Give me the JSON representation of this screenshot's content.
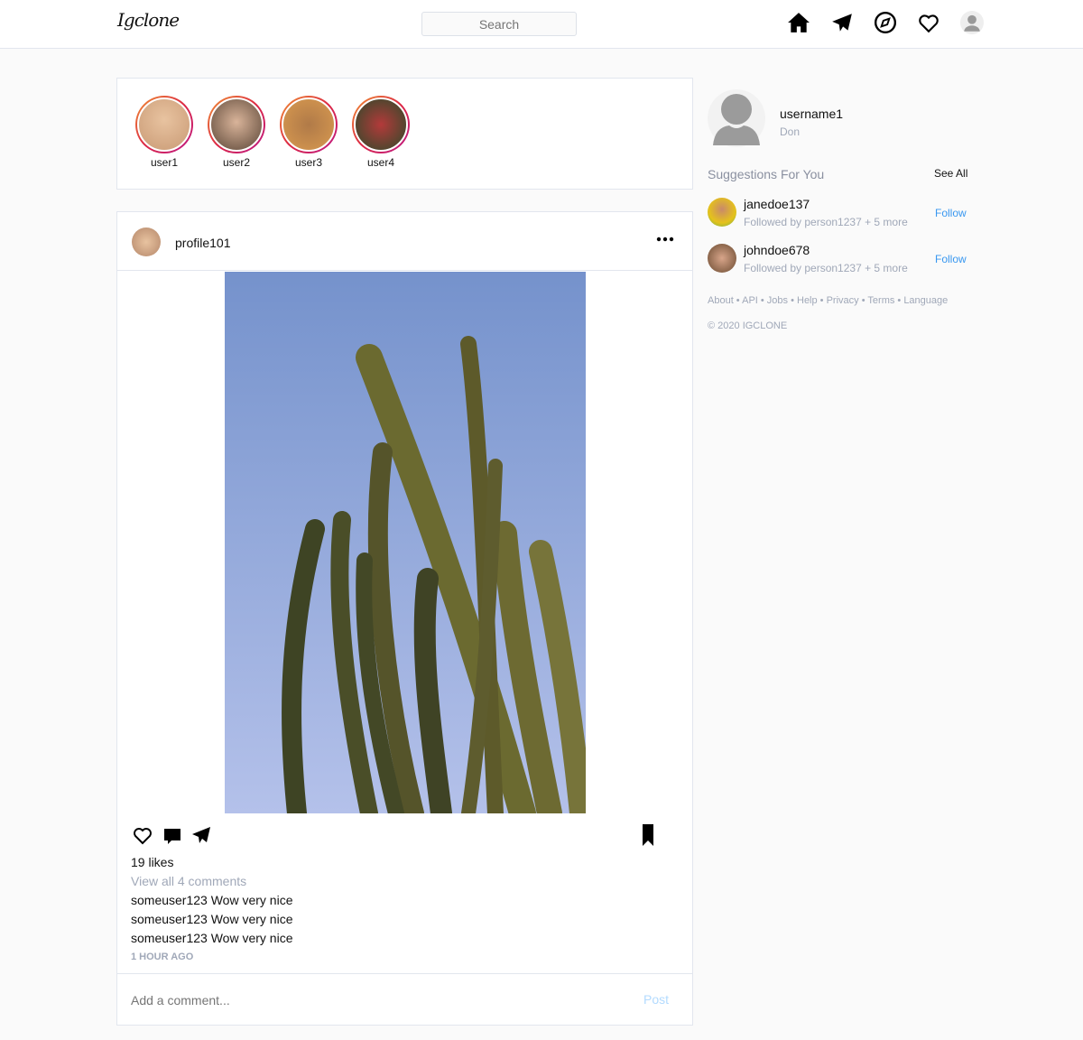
{
  "header": {
    "logo": "Igclone",
    "search_placeholder": "Search",
    "icons": [
      "home-icon",
      "send-icon",
      "explore-icon",
      "heart-icon",
      "profile-icon"
    ]
  },
  "stories": [
    {
      "label": "user1"
    },
    {
      "label": "user2"
    },
    {
      "label": "user3"
    },
    {
      "label": "user4"
    }
  ],
  "post": {
    "username": "profile101",
    "likes": "19 likes",
    "view_comments": "View all 4 comments",
    "comments": [
      {
        "user": "someuser123",
        "text": "Wow very nice"
      },
      {
        "user": "someuser123",
        "text": "Wow very nice"
      },
      {
        "user": "someuser123",
        "text": "Wow very nice"
      }
    ],
    "time": "1 HOUR AGO",
    "comment_placeholder": "Add a comment...",
    "post_label": "Post"
  },
  "sidebar": {
    "username": "username1",
    "name": "Don",
    "suggestions_title": "Suggestions For You",
    "see_all": "See All",
    "suggestions": [
      {
        "username": "janedoe137",
        "sub": "Followed by person1237 + 5 more",
        "action": "Follow"
      },
      {
        "username": "johndoe678",
        "sub": "Followed by person1237 + 5 more",
        "action": "Follow"
      }
    ],
    "footer_links": "About • API • Jobs • Help • Privacy • Terms • Language",
    "copyright": "© 2020 IGCLONE"
  },
  "colors": {
    "accent": "#3897f0",
    "border": "#e2e6ee"
  }
}
